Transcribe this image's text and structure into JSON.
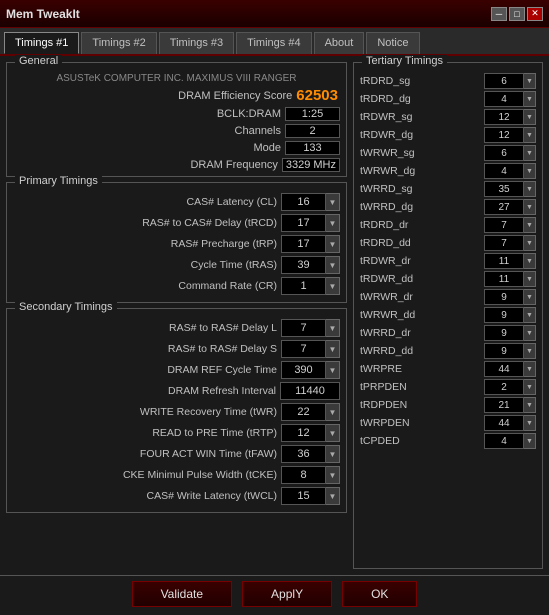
{
  "window": {
    "title": "Mem TweakIt",
    "min_btn": "─",
    "max_btn": "□",
    "close_btn": "✕"
  },
  "tabs": [
    {
      "label": "Timings #1",
      "active": true
    },
    {
      "label": "Timings #2",
      "active": false
    },
    {
      "label": "Timings #3",
      "active": false
    },
    {
      "label": "Timings #4",
      "active": false
    },
    {
      "label": "About",
      "active": false
    },
    {
      "label": "Notice",
      "active": false
    }
  ],
  "general": {
    "title": "General",
    "mobo": "ASUSTeK COMPUTER INC. MAXIMUS VIII RANGER",
    "dram_score_label": "DRAM Efficiency Score",
    "dram_score_value": "62503",
    "rows": [
      {
        "label": "BCLK:DRAM",
        "value": "1:25"
      },
      {
        "label": "Channels",
        "value": "2"
      },
      {
        "label": "Mode",
        "value": "133"
      },
      {
        "label": "DRAM Frequency",
        "value": "3329 MHz"
      }
    ]
  },
  "primary": {
    "title": "Primary Timings",
    "rows": [
      {
        "label": "CAS# Latency (CL)",
        "value": "16"
      },
      {
        "label": "RAS# to CAS# Delay (tRCD)",
        "value": "17"
      },
      {
        "label": "RAS# Precharge (tRP)",
        "value": "17"
      },
      {
        "label": "Cycle Time (tRAS)",
        "value": "39"
      },
      {
        "label": "Command Rate (CR)",
        "value": "1"
      }
    ]
  },
  "secondary": {
    "title": "Secondary Timings",
    "rows": [
      {
        "label": "RAS# to RAS# Delay L",
        "value": "7"
      },
      {
        "label": "RAS# to RAS# Delay S",
        "value": "7"
      },
      {
        "label": "DRAM REF Cycle Time",
        "value": "390"
      },
      {
        "label": "DRAM Refresh Interval",
        "value": "11440"
      },
      {
        "label": "WRITE Recovery Time (tWR)",
        "value": "22"
      },
      {
        "label": "READ to PRE Time (tRTP)",
        "value": "12"
      },
      {
        "label": "FOUR ACT WIN Time (tFAW)",
        "value": "36"
      },
      {
        "label": "CKE Minimul Pulse Width (tCKE)",
        "value": "8"
      },
      {
        "label": "CAS# Write Latency (tWCL)",
        "value": "15"
      }
    ]
  },
  "tertiary": {
    "title": "Tertiary Timings",
    "rows": [
      {
        "label": "tRDRD_sg",
        "value": "6"
      },
      {
        "label": "tRDRD_dg",
        "value": "4"
      },
      {
        "label": "tRDWR_sg",
        "value": "12"
      },
      {
        "label": "tRDWR_dg",
        "value": "12"
      },
      {
        "label": "tWRWR_sg",
        "value": "6"
      },
      {
        "label": "tWRWR_dg",
        "value": "4"
      },
      {
        "label": "tWRRD_sg",
        "value": "35"
      },
      {
        "label": "tWRRD_dg",
        "value": "27"
      },
      {
        "label": "tRDRD_dr",
        "value": "7"
      },
      {
        "label": "tRDRD_dd",
        "value": "7"
      },
      {
        "label": "tRDWR_dr",
        "value": "11"
      },
      {
        "label": "tRDWR_dd",
        "value": "11"
      },
      {
        "label": "tWRWR_dr",
        "value": "9"
      },
      {
        "label": "tWRWR_dd",
        "value": "9"
      },
      {
        "label": "tWRRD_dr",
        "value": "9"
      },
      {
        "label": "tWRRD_dd",
        "value": "9"
      },
      {
        "label": "tWRPRE",
        "value": "44"
      },
      {
        "label": "tPRPDEN",
        "value": "2"
      },
      {
        "label": "tRDPDEN",
        "value": "21"
      },
      {
        "label": "tWRPDEN",
        "value": "44"
      },
      {
        "label": "tCPDED",
        "value": "4"
      }
    ]
  },
  "buttons": {
    "validate": "Validate",
    "apply": "ApplY",
    "ok": "OK"
  }
}
